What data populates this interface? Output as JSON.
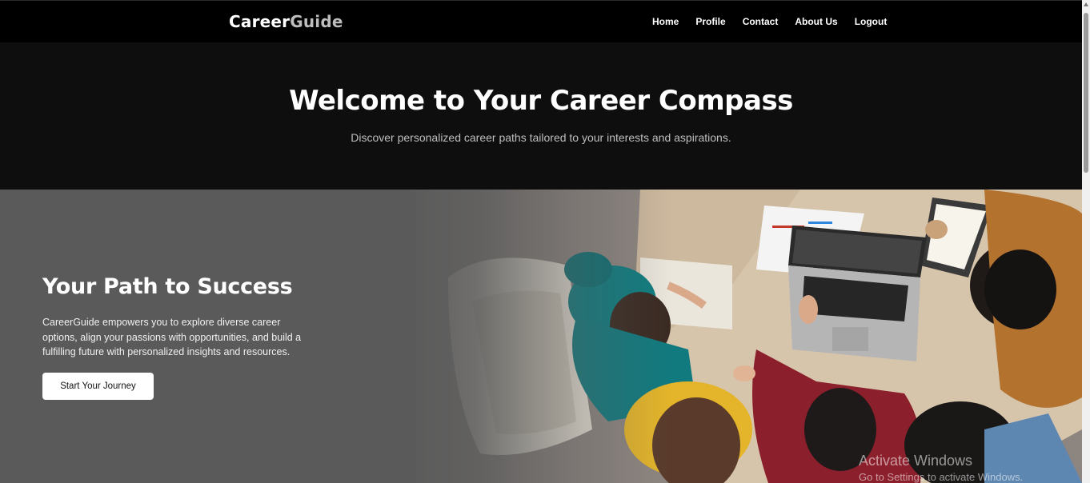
{
  "brand": {
    "part1": "Career",
    "part2": "Guide"
  },
  "nav": {
    "items": [
      {
        "label": "Home"
      },
      {
        "label": "Profile"
      },
      {
        "label": "Contact"
      },
      {
        "label": "About Us"
      },
      {
        "label": "Logout"
      }
    ]
  },
  "hero": {
    "title": "Welcome to Your Career Compass",
    "subtitle": "Discover personalized career paths tailored to your interests and aspirations."
  },
  "section": {
    "title": "Your Path to Success",
    "text": "CareerGuide empowers you to explore diverse career options, align your passions with opportunities, and build a fulfilling future with personalized insights and resources.",
    "cta_label": "Start Your Journey"
  },
  "watermark": {
    "line1": "Activate Windows",
    "line2": "Go to Settings to activate Windows."
  },
  "colors": {
    "header_bg": "#000000",
    "hero_bg": "#0e0e0e",
    "section_bg": "#595959",
    "cta_bg": "#ffffff"
  }
}
